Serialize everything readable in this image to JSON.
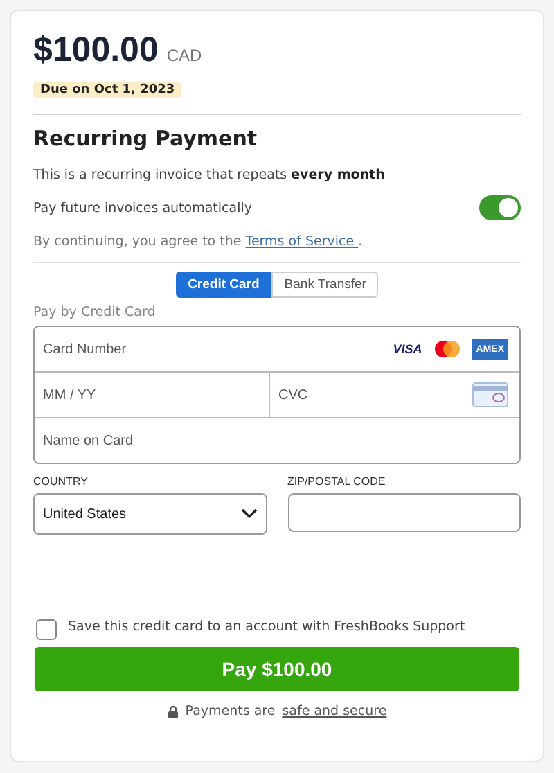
{
  "amount": "$100.00",
  "currency": "CAD",
  "due": "Due on Oct 1, 2023",
  "recurring": {
    "heading": "Recurring Payment",
    "description": "This is a recurring invoice that repeats **every month**",
    "autopay_label": "Pay future invoices automatically",
    "autopay_on": true,
    "terms_prefix": "By continuing, you agree to the",
    "terms_link": "Terms of Service ",
    "terms_suffix": "."
  },
  "tabs": [
    {
      "label": "Credit Card",
      "selected": true
    },
    {
      "label": "Bank Transfer",
      "selected": false
    }
  ],
  "section_label": "Pay by Credit Card",
  "card_fields": {
    "number": {
      "placeholder": "Card Number"
    },
    "brands": [
      "VISA",
      "AMEX"
    ],
    "expiry": {
      "placeholder": "MM / YY"
    },
    "cvc": {
      "placeholder": "CVC"
    },
    "name": {
      "placeholder": "Name on Card"
    }
  },
  "country": {
    "label": "COUNTRY",
    "value": "United States"
  },
  "zip": {
    "label": "ZIP/POSTAL CODE"
  },
  "save_card": {
    "label": "Save this credit card to an account with FreshBooks Support",
    "checked": false
  },
  "pay_button": "Pay $100.00",
  "secure_prefix": "Payments are",
  "secure_link": "safe and secure"
}
